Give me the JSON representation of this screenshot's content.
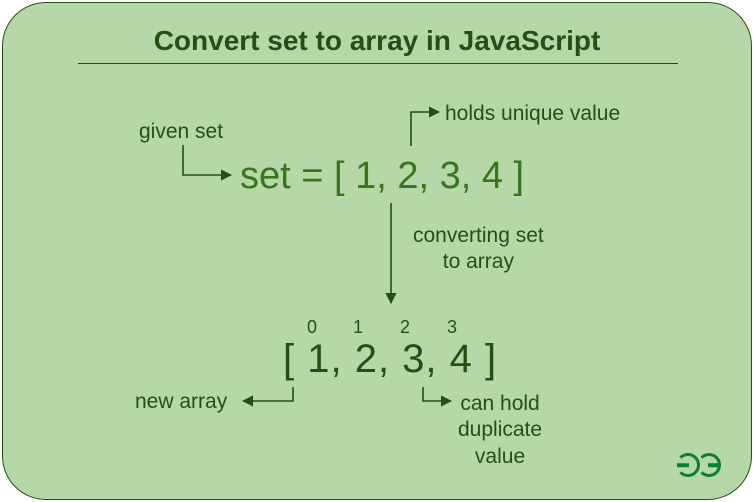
{
  "title": "Convert set to array in JavaScript",
  "labels": {
    "given_set": "given set",
    "holds_unique": "holds unique value",
    "converting": "converting set\nto array",
    "new_array": "new array",
    "can_hold_dup": "can hold\nduplicate\nvalue"
  },
  "set_expression": "set = [ 1, 2, 3, 4 ]",
  "array_expression": "[ 1, 2, 3, 4 ]",
  "array_indices": [
    "0",
    "1",
    "2",
    "3"
  ],
  "colors": {
    "bg": "#b6d7a8",
    "fg_dark": "#274e13",
    "fg_mid": "#38761d",
    "logo": "#0f7b3e"
  }
}
